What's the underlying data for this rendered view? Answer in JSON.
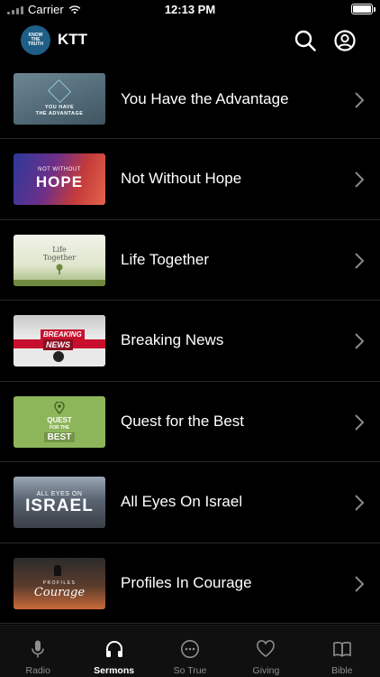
{
  "status_bar": {
    "carrier": "Carrier",
    "time": "12:13 PM",
    "battery_level": 1.0
  },
  "header": {
    "app_title": "KTT",
    "logo_text_top": "KNOW",
    "logo_text_mid": "THE",
    "logo_text_bottom": "TRUTH",
    "search_icon": "search-icon",
    "profile_icon": "account-circle-icon"
  },
  "sermons": [
    {
      "title": "You Have the Advantage",
      "thumb_line1": "YOU HAVE",
      "thumb_line2": "THE ADVANTAGE"
    },
    {
      "title": "Not Without Hope",
      "thumb_line1": "NOT WITHOUT",
      "thumb_line2": "HOPE"
    },
    {
      "title": "Life Together",
      "thumb_line1": "Life",
      "thumb_line2": "Together"
    },
    {
      "title": "Breaking News",
      "thumb_line1": "BREAKING",
      "thumb_line2": "NEWS"
    },
    {
      "title": "Quest for the Best",
      "thumb_line1": "QUEST",
      "thumb_line2": "FOR THE",
      "thumb_line3": "BEST"
    },
    {
      "title": "All Eyes On Israel",
      "thumb_line1": "ALL EYES ON",
      "thumb_line2": "ISRAEL"
    },
    {
      "title": "Profiles In Courage",
      "thumb_line1": "PROFILES",
      "thumb_line2": "Courage"
    }
  ],
  "tabs": [
    {
      "label": "Radio",
      "icon": "microphone-icon",
      "active": false
    },
    {
      "label": "Sermons",
      "icon": "headphones-icon",
      "active": true
    },
    {
      "label": "So True",
      "icon": "chat-bubble-icon",
      "active": false
    },
    {
      "label": "Giving",
      "icon": "heart-icon",
      "active": false
    },
    {
      "label": "Bible",
      "icon": "book-icon",
      "active": false
    }
  ],
  "colors": {
    "background": "#000000",
    "text": "#ffffff",
    "separator": "#2a2a2a",
    "tab_inactive": "#8e8e8e",
    "tab_active": "#ffffff",
    "logo_blue": "#1f5e86"
  }
}
